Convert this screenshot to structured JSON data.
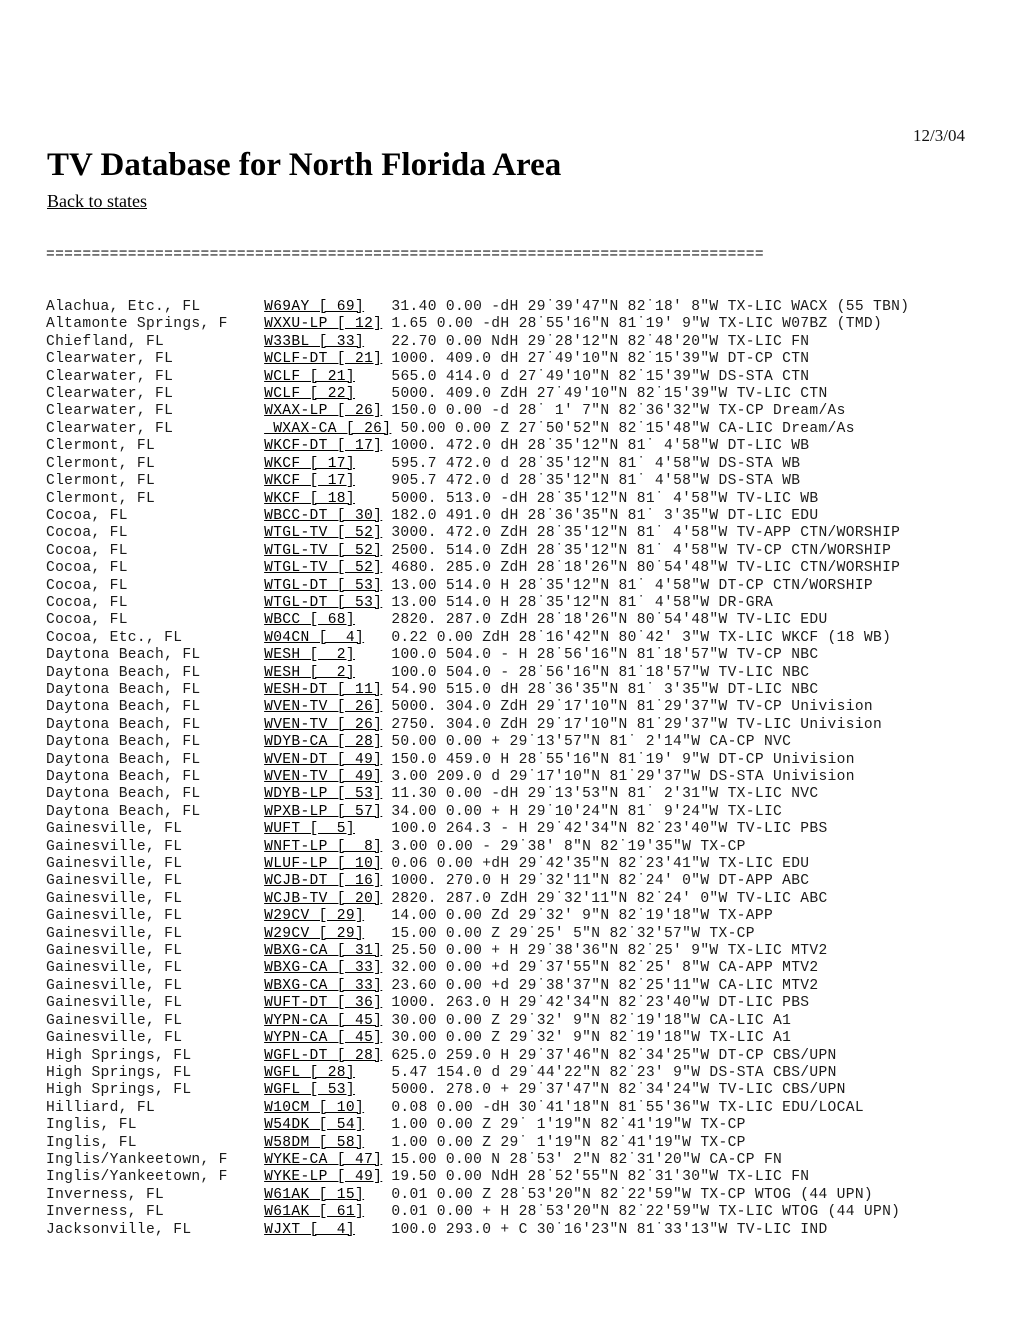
{
  "document": {
    "date": "12/3/04",
    "title": "TV Database for North Florida Area",
    "back_link": "Back to states",
    "separator": "==============================================================================="
  },
  "listing": {
    "column_widths": {
      "place": 24,
      "call": 13
    },
    "rows": [
      {
        "place": "Alachua, Etc., FL",
        "call": "W69AY [ 69]",
        "rest": "31.40 0.00 -dH 29˙39'47\"N 82˙18' 8\"W TX-LIC WACX (55 TBN)"
      },
      {
        "place": "Altamonte Springs, F",
        "call": "WXXU-LP [ 12]",
        "rest": "1.65 0.00 -dH 28˙55'16\"N 81˙19' 9\"W TX-LIC W07BZ (TMD)"
      },
      {
        "place": "Chiefland, FL",
        "call": "W33BL [ 33]",
        "rest": "22.70 0.00 NdH 29˙28'12\"N 82˙48'20\"W TX-LIC FN"
      },
      {
        "place": "Clearwater, FL",
        "call": "WCLF-DT [ 21]",
        "rest": "1000. 409.0 dH 27˙49'10\"N 82˙15'39\"W DT-CP CTN"
      },
      {
        "place": "Clearwater, FL",
        "call": "WCLF [ 21]",
        "rest": "565.0 414.0 d 27˙49'10\"N 82˙15'39\"W DS-STA CTN"
      },
      {
        "place": "Clearwater, FL",
        "call": "WCLF [ 22]",
        "rest": "5000. 409.0 ZdH 27˙49'10\"N 82˙15'39\"W TV-LIC CTN"
      },
      {
        "place": "Clearwater, FL",
        "call": "WXAX-LP [ 26]",
        "rest": "150.0 0.00 -d 28˙ 1' 7\"N 82˙36'32\"W TX-CP Dream/As"
      },
      {
        "place": "Clearwater, FL",
        "call": " WXAX-CA [ 26]",
        "rest": "50.00 0.00 Z 27˙50'52\"N 82˙15'48\"W CA-LIC Dream/As"
      },
      {
        "place": "Clermont, FL",
        "call": "WKCF-DT [ 17]",
        "rest": "1000. 472.0 dH 28˙35'12\"N 81˙ 4'58\"W DT-LIC WB"
      },
      {
        "place": "Clermont, FL",
        "call": "WKCF [ 17]",
        "rest": "595.7 472.0 d 28˙35'12\"N 81˙ 4'58\"W DS-STA WB"
      },
      {
        "place": "Clermont, FL",
        "call": "WKCF [ 17]",
        "rest": "905.7 472.0 d 28˙35'12\"N 81˙ 4'58\"W DS-STA WB"
      },
      {
        "place": "Clermont, FL",
        "call": "WKCF [ 18]",
        "rest": "5000. 513.0 -dH 28˙35'12\"N 81˙ 4'58\"W TV-LIC WB"
      },
      {
        "place": "Cocoa, FL",
        "call": "WBCC-DT [ 30]",
        "rest": "182.0 491.0 dH 28˙36'35\"N 81˙ 3'35\"W DT-LIC EDU"
      },
      {
        "place": "Cocoa, FL",
        "call": "WTGL-TV [ 52]",
        "rest": "3000. 472.0 ZdH 28˙35'12\"N 81˙ 4'58\"W TV-APP CTN/WORSHIP"
      },
      {
        "place": "Cocoa, FL",
        "call": "WTGL-TV [ 52]",
        "rest": "2500. 514.0 ZdH 28˙35'12\"N 81˙ 4'58\"W TV-CP CTN/WORSHIP"
      },
      {
        "place": "Cocoa, FL",
        "call": "WTGL-TV [ 52]",
        "rest": "4680. 285.0 ZdH 28˙18'26\"N 80˙54'48\"W TV-LIC CTN/WORSHIP"
      },
      {
        "place": "Cocoa, FL",
        "call": "WTGL-DT [ 53]",
        "rest": "13.00 514.0 H 28˙35'12\"N 81˙ 4'58\"W DT-CP CTN/WORSHIP"
      },
      {
        "place": "Cocoa, FL",
        "call": "WTGL-DT [ 53]",
        "rest": "13.00 514.0 H 28˙35'12\"N 81˙ 4'58\"W DR-GRA"
      },
      {
        "place": "Cocoa, FL",
        "call": "WBCC [ 68]",
        "rest": "2820. 287.0 ZdH 28˙18'26\"N 80˙54'48\"W TV-LIC EDU"
      },
      {
        "place": "Cocoa, Etc., FL",
        "call": "W04CN [  4]",
        "rest": "0.22 0.00 ZdH 28˙16'42\"N 80˙42' 3\"W TX-LIC WKCF (18 WB)"
      },
      {
        "place": "Daytona Beach, FL",
        "call": "WESH [  2]",
        "rest": "100.0 504.0 - H 28˙56'16\"N 81˙18'57\"W TV-CP NBC"
      },
      {
        "place": "Daytona Beach, FL",
        "call": "WESH [  2]",
        "rest": "100.0 504.0 - 28˙56'16\"N 81˙18'57\"W TV-LIC NBC"
      },
      {
        "place": "Daytona Beach, FL",
        "call": "WESH-DT [ 11]",
        "rest": "54.90 515.0 dH 28˙36'35\"N 81˙ 3'35\"W DT-LIC NBC"
      },
      {
        "place": "Daytona Beach, FL",
        "call": "WVEN-TV [ 26]",
        "rest": "5000. 304.0 ZdH 29˙17'10\"N 81˙29'37\"W TV-CP Univision"
      },
      {
        "place": "Daytona Beach, FL",
        "call": "WVEN-TV [ 26]",
        "rest": "2750. 304.0 ZdH 29˙17'10\"N 81˙29'37\"W TV-LIC Univision"
      },
      {
        "place": "Daytona Beach, FL",
        "call": "WDYB-CA [ 28]",
        "rest": "50.00 0.00 + 29˙13'57\"N 81˙ 2'14\"W CA-CP NVC"
      },
      {
        "place": "Daytona Beach, FL",
        "call": "WVEN-DT [ 49]",
        "rest": "150.0 459.0 H 28˙55'16\"N 81˙19' 9\"W DT-CP Univision"
      },
      {
        "place": "Daytona Beach, FL",
        "call": "WVEN-TV [ 49]",
        "rest": "3.00 209.0 d 29˙17'10\"N 81˙29'37\"W DS-STA Univision"
      },
      {
        "place": "Daytona Beach, FL",
        "call": "WDYB-LP [ 53]",
        "rest": "11.30 0.00 -dH 29˙13'53\"N 81˙ 2'31\"W TX-LIC NVC"
      },
      {
        "place": "Daytona Beach, FL",
        "call": "WPXB-LP [ 57]",
        "rest": "34.00 0.00 + H 29˙10'24\"N 81˙ 9'24\"W TX-LIC"
      },
      {
        "place": "Gainesville, FL",
        "call": "WUFT [  5]",
        "rest": "100.0 264.3 - H 29˙42'34\"N 82˙23'40\"W TV-LIC PBS"
      },
      {
        "place": "Gainesville, FL",
        "call": "WNFT-LP [  8]",
        "rest": "3.00 0.00 - 29˙38' 8\"N 82˙19'35\"W TX-CP"
      },
      {
        "place": "Gainesville, FL",
        "call": "WLUF-LP [ 10]",
        "rest": "0.06 0.00 +dH 29˙42'35\"N 82˙23'41\"W TX-LIC EDU"
      },
      {
        "place": "Gainesville, FL",
        "call": "WCJB-DT [ 16]",
        "rest": "1000. 270.0 H 29˙32'11\"N 82˙24' 0\"W DT-APP ABC"
      },
      {
        "place": "Gainesville, FL",
        "call": "WCJB-TV [ 20]",
        "rest": "2820. 287.0 ZdH 29˙32'11\"N 82˙24' 0\"W TV-LIC ABC"
      },
      {
        "place": "Gainesville, FL",
        "call": "W29CV [ 29]",
        "rest": "14.00 0.00 Zd 29˙32' 9\"N 82˙19'18\"W TX-APP"
      },
      {
        "place": "Gainesville, FL",
        "call": "W29CV [ 29]",
        "rest": "15.00 0.00 Z 29˙25' 5\"N 82˙32'57\"W TX-CP"
      },
      {
        "place": "Gainesville, FL",
        "call": "WBXG-CA [ 31]",
        "rest": "25.50 0.00 + H 29˙38'36\"N 82˙25' 9\"W TX-LIC MTV2"
      },
      {
        "place": "Gainesville, FL",
        "call": "WBXG-CA [ 33]",
        "rest": "32.00 0.00 +d 29˙37'55\"N 82˙25' 8\"W CA-APP MTV2"
      },
      {
        "place": "Gainesville, FL",
        "call": "WBXG-CA [ 33]",
        "rest": "23.60 0.00 +d 29˙38'37\"N 82˙25'11\"W CA-LIC MTV2"
      },
      {
        "place": "Gainesville, FL",
        "call": "WUFT-DT [ 36]",
        "rest": "1000. 263.0 H 29˙42'34\"N 82˙23'40\"W DT-LIC PBS"
      },
      {
        "place": "Gainesville, FL",
        "call": "WYPN-CA [ 45]",
        "rest": "30.00 0.00 Z 29˙32' 9\"N 82˙19'18\"W CA-LIC A1"
      },
      {
        "place": "Gainesville, FL",
        "call": "WYPN-CA [ 45]",
        "rest": "30.00 0.00 Z 29˙32' 9\"N 82˙19'18\"W TX-LIC A1"
      },
      {
        "place": "High Springs, FL",
        "call": "WGFL-DT [ 28]",
        "rest": "625.0 259.0 H 29˙37'46\"N 82˙34'25\"W DT-CP CBS/UPN"
      },
      {
        "place": "High Springs, FL",
        "call": "WGFL [ 28]",
        "rest": "5.47 154.0 d 29˙44'22\"N 82˙23' 9\"W DS-STA CBS/UPN"
      },
      {
        "place": "High Springs, FL",
        "call": "WGFL [ 53]",
        "rest": "5000. 278.0 + 29˙37'47\"N 82˙34'24\"W TV-LIC CBS/UPN"
      },
      {
        "place": "Hilliard, FL",
        "call": "W10CM [ 10]",
        "rest": "0.08 0.00 -dH 30˙41'18\"N 81˙55'36\"W TX-LIC EDU/LOCAL"
      },
      {
        "place": "Inglis, FL",
        "call": "W54DK [ 54]",
        "rest": "1.00 0.00 Z 29˙ 1'19\"N 82˙41'19\"W TX-CP"
      },
      {
        "place": "Inglis, FL",
        "call": "W58DM [ 58]",
        "rest": "1.00 0.00 Z 29˙ 1'19\"N 82˙41'19\"W TX-CP"
      },
      {
        "place": "Inglis/Yankeetown, F",
        "call": "WYKE-CA [ 47]",
        "rest": "15.00 0.00 N 28˙53' 2\"N 82˙31'20\"W CA-CP FN"
      },
      {
        "place": "Inglis/Yankeetown, F",
        "call": "WYKE-LP [ 49]",
        "rest": "19.50 0.00 NdH 28˙52'55\"N 82˙31'30\"W TX-LIC FN"
      },
      {
        "place": "Inverness, FL",
        "call": "W61AK [ 15]",
        "rest": "0.01 0.00 Z 28˙53'20\"N 82˙22'59\"W TX-CP WTOG (44 UPN)"
      },
      {
        "place": "Inverness, FL",
        "call": "W61AK [ 61]",
        "rest": "0.01 0.00 + H 28˙53'20\"N 82˙22'59\"W TX-LIC WTOG (44 UPN)"
      },
      {
        "place": "Jacksonville, FL",
        "call": "WJXT [  4]",
        "rest": "100.0 293.0 + C 30˙16'23\"N 81˙33'13\"W TV-LIC IND"
      }
    ]
  }
}
